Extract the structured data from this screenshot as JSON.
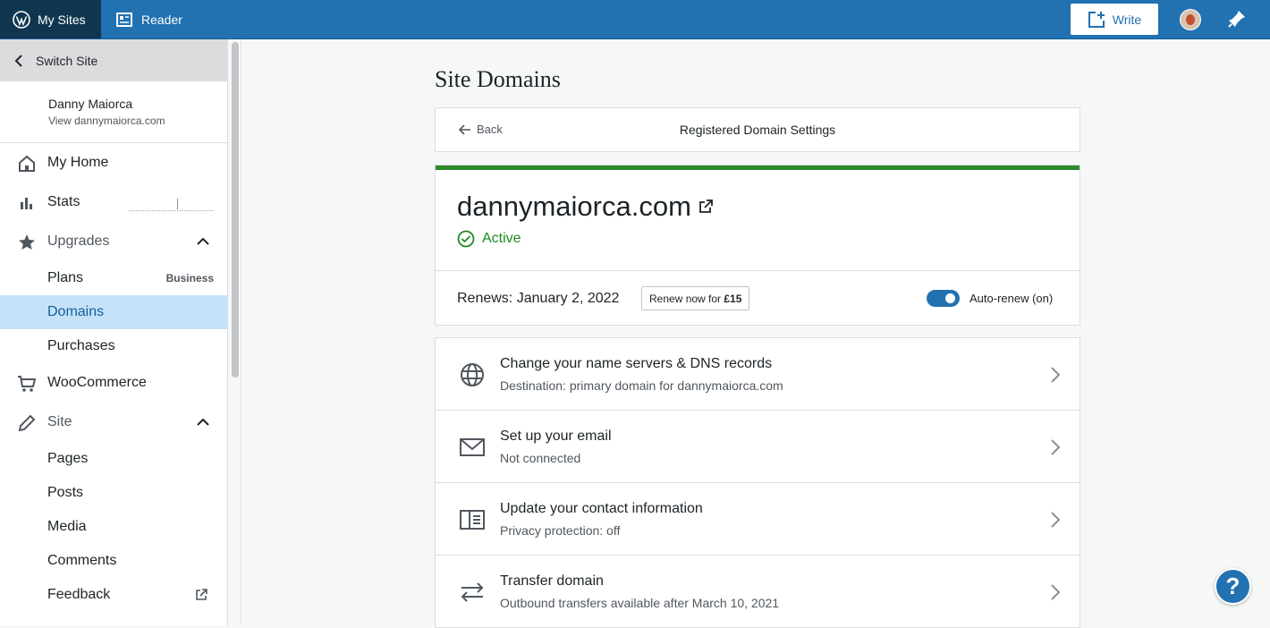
{
  "masterbar": {
    "my_sites": "My Sites",
    "reader": "Reader",
    "write": "Write"
  },
  "sidebar": {
    "switch_site": "Switch Site",
    "site_name": "Danny Maiorca",
    "site_url": "View dannymaiorca.com",
    "items": [
      {
        "label": "My Home"
      },
      {
        "label": "Stats"
      },
      {
        "label": "Upgrades"
      },
      {
        "label": "Plans",
        "badge": "Business"
      },
      {
        "label": "Domains"
      },
      {
        "label": "Purchases"
      },
      {
        "label": "WooCommerce"
      },
      {
        "label": "Site"
      },
      {
        "label": "Pages"
      },
      {
        "label": "Posts"
      },
      {
        "label": "Media"
      },
      {
        "label": "Comments"
      },
      {
        "label": "Feedback"
      }
    ]
  },
  "main": {
    "page_title": "Site Domains",
    "back": "Back",
    "header_title": "Registered Domain Settings",
    "domain": {
      "name": "dannymaiorca.com",
      "status": "Active",
      "renews": "Renews: January 2, 2022",
      "renew_now_prefix": "Renew now for ",
      "renew_price": "£15",
      "auto_renew": "Auto-renew (on)"
    },
    "rows": [
      {
        "title": "Change your name servers & DNS records",
        "desc": "Destination: primary domain for dannymaiorca.com",
        "icon": "globe-icon"
      },
      {
        "title": "Set up your email",
        "desc": "Not connected",
        "icon": "mail-icon"
      },
      {
        "title": "Update your contact information",
        "desc": "Privacy protection: off",
        "icon": "contact-card-icon"
      },
      {
        "title": "Transfer domain",
        "desc": "Outbound transfers available after March 10, 2021",
        "icon": "transfer-arrows-icon"
      }
    ]
  },
  "help": "?",
  "colors": {
    "accent": "#2271b1",
    "active_green": "#1e8a1e",
    "active_bar": "#2d8a2d",
    "selected_nav_bg": "#c5e2f8"
  }
}
